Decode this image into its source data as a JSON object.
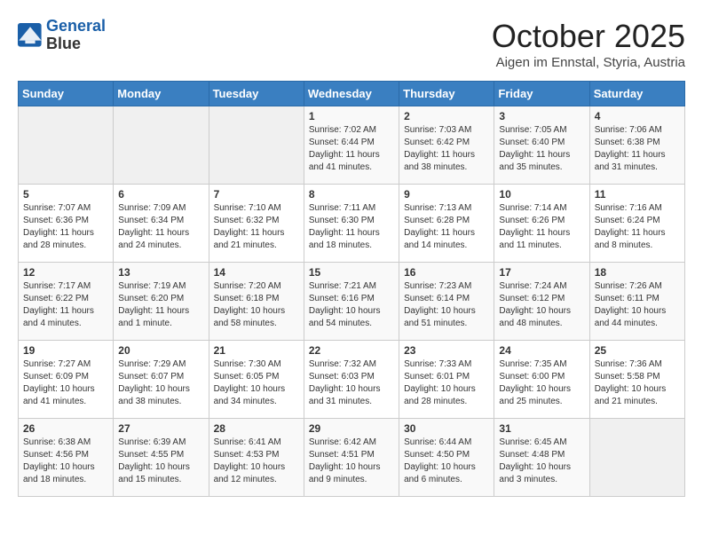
{
  "logo": {
    "line1": "General",
    "line2": "Blue"
  },
  "title": "October 2025",
  "subtitle": "Aigen im Ennstal, Styria, Austria",
  "weekdays": [
    "Sunday",
    "Monday",
    "Tuesday",
    "Wednesday",
    "Thursday",
    "Friday",
    "Saturday"
  ],
  "weeks": [
    [
      {
        "day": "",
        "info": ""
      },
      {
        "day": "",
        "info": ""
      },
      {
        "day": "",
        "info": ""
      },
      {
        "day": "1",
        "info": "Sunrise: 7:02 AM\nSunset: 6:44 PM\nDaylight: 11 hours\nand 41 minutes."
      },
      {
        "day": "2",
        "info": "Sunrise: 7:03 AM\nSunset: 6:42 PM\nDaylight: 11 hours\nand 38 minutes."
      },
      {
        "day": "3",
        "info": "Sunrise: 7:05 AM\nSunset: 6:40 PM\nDaylight: 11 hours\nand 35 minutes."
      },
      {
        "day": "4",
        "info": "Sunrise: 7:06 AM\nSunset: 6:38 PM\nDaylight: 11 hours\nand 31 minutes."
      }
    ],
    [
      {
        "day": "5",
        "info": "Sunrise: 7:07 AM\nSunset: 6:36 PM\nDaylight: 11 hours\nand 28 minutes."
      },
      {
        "day": "6",
        "info": "Sunrise: 7:09 AM\nSunset: 6:34 PM\nDaylight: 11 hours\nand 24 minutes."
      },
      {
        "day": "7",
        "info": "Sunrise: 7:10 AM\nSunset: 6:32 PM\nDaylight: 11 hours\nand 21 minutes."
      },
      {
        "day": "8",
        "info": "Sunrise: 7:11 AM\nSunset: 6:30 PM\nDaylight: 11 hours\nand 18 minutes."
      },
      {
        "day": "9",
        "info": "Sunrise: 7:13 AM\nSunset: 6:28 PM\nDaylight: 11 hours\nand 14 minutes."
      },
      {
        "day": "10",
        "info": "Sunrise: 7:14 AM\nSunset: 6:26 PM\nDaylight: 11 hours\nand 11 minutes."
      },
      {
        "day": "11",
        "info": "Sunrise: 7:16 AM\nSunset: 6:24 PM\nDaylight: 11 hours\nand 8 minutes."
      }
    ],
    [
      {
        "day": "12",
        "info": "Sunrise: 7:17 AM\nSunset: 6:22 PM\nDaylight: 11 hours\nand 4 minutes."
      },
      {
        "day": "13",
        "info": "Sunrise: 7:19 AM\nSunset: 6:20 PM\nDaylight: 11 hours\nand 1 minute."
      },
      {
        "day": "14",
        "info": "Sunrise: 7:20 AM\nSunset: 6:18 PM\nDaylight: 10 hours\nand 58 minutes."
      },
      {
        "day": "15",
        "info": "Sunrise: 7:21 AM\nSunset: 6:16 PM\nDaylight: 10 hours\nand 54 minutes."
      },
      {
        "day": "16",
        "info": "Sunrise: 7:23 AM\nSunset: 6:14 PM\nDaylight: 10 hours\nand 51 minutes."
      },
      {
        "day": "17",
        "info": "Sunrise: 7:24 AM\nSunset: 6:12 PM\nDaylight: 10 hours\nand 48 minutes."
      },
      {
        "day": "18",
        "info": "Sunrise: 7:26 AM\nSunset: 6:11 PM\nDaylight: 10 hours\nand 44 minutes."
      }
    ],
    [
      {
        "day": "19",
        "info": "Sunrise: 7:27 AM\nSunset: 6:09 PM\nDaylight: 10 hours\nand 41 minutes."
      },
      {
        "day": "20",
        "info": "Sunrise: 7:29 AM\nSunset: 6:07 PM\nDaylight: 10 hours\nand 38 minutes."
      },
      {
        "day": "21",
        "info": "Sunrise: 7:30 AM\nSunset: 6:05 PM\nDaylight: 10 hours\nand 34 minutes."
      },
      {
        "day": "22",
        "info": "Sunrise: 7:32 AM\nSunset: 6:03 PM\nDaylight: 10 hours\nand 31 minutes."
      },
      {
        "day": "23",
        "info": "Sunrise: 7:33 AM\nSunset: 6:01 PM\nDaylight: 10 hours\nand 28 minutes."
      },
      {
        "day": "24",
        "info": "Sunrise: 7:35 AM\nSunset: 6:00 PM\nDaylight: 10 hours\nand 25 minutes."
      },
      {
        "day": "25",
        "info": "Sunrise: 7:36 AM\nSunset: 5:58 PM\nDaylight: 10 hours\nand 21 minutes."
      }
    ],
    [
      {
        "day": "26",
        "info": "Sunrise: 6:38 AM\nSunset: 4:56 PM\nDaylight: 10 hours\nand 18 minutes."
      },
      {
        "day": "27",
        "info": "Sunrise: 6:39 AM\nSunset: 4:55 PM\nDaylight: 10 hours\nand 15 minutes."
      },
      {
        "day": "28",
        "info": "Sunrise: 6:41 AM\nSunset: 4:53 PM\nDaylight: 10 hours\nand 12 minutes."
      },
      {
        "day": "29",
        "info": "Sunrise: 6:42 AM\nSunset: 4:51 PM\nDaylight: 10 hours\nand 9 minutes."
      },
      {
        "day": "30",
        "info": "Sunrise: 6:44 AM\nSunset: 4:50 PM\nDaylight: 10 hours\nand 6 minutes."
      },
      {
        "day": "31",
        "info": "Sunrise: 6:45 AM\nSunset: 4:48 PM\nDaylight: 10 hours\nand 3 minutes."
      },
      {
        "day": "",
        "info": ""
      }
    ]
  ]
}
